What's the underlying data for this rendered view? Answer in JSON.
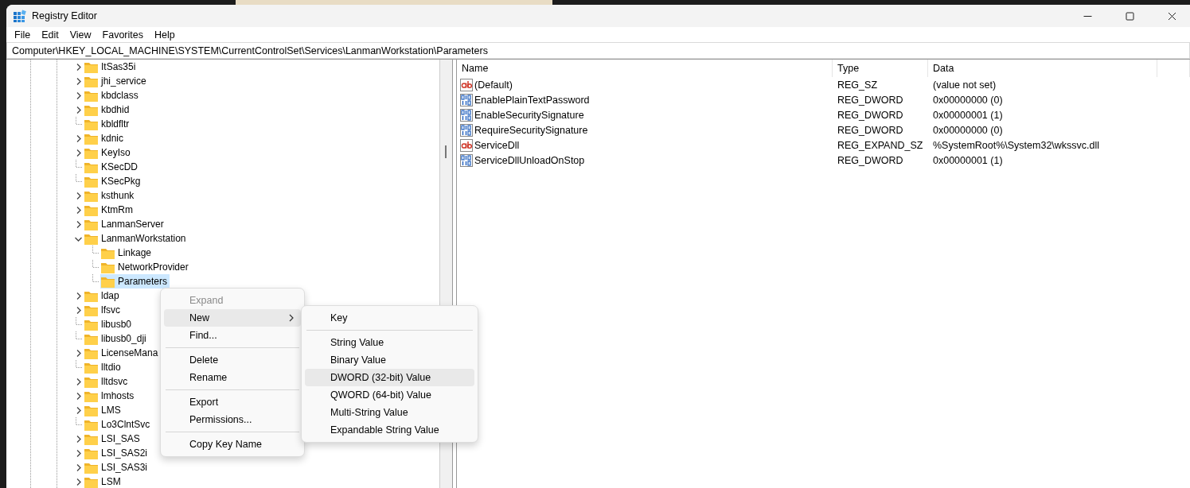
{
  "window": {
    "title": "Registry Editor"
  },
  "menu_bar": [
    {
      "label": "File"
    },
    {
      "label": "Edit"
    },
    {
      "label": "View"
    },
    {
      "label": "Favorites"
    },
    {
      "label": "Help"
    }
  ],
  "address_bar": {
    "value": "Computer\\HKEY_LOCAL_MACHINE\\SYSTEM\\CurrentControlSet\\Services\\LanmanWorkstation\\Parameters"
  },
  "tree": {
    "items": [
      {
        "label": "ItSas35i",
        "expandable": true,
        "expanded": false,
        "selected": false
      },
      {
        "label": "jhi_service",
        "expandable": true,
        "expanded": false,
        "selected": false
      },
      {
        "label": "kbdclass",
        "expandable": true,
        "expanded": false,
        "selected": false
      },
      {
        "label": "kbdhid",
        "expandable": true,
        "expanded": false,
        "selected": false
      },
      {
        "label": "kbldfltr",
        "expandable": false,
        "selected": false
      },
      {
        "label": "kdnic",
        "expandable": true,
        "expanded": false,
        "selected": false
      },
      {
        "label": "KeyIso",
        "expandable": true,
        "expanded": false,
        "selected": false
      },
      {
        "label": "KSecDD",
        "expandable": false,
        "selected": false
      },
      {
        "label": "KSecPkg",
        "expandable": false,
        "selected": false
      },
      {
        "label": "ksthunk",
        "expandable": true,
        "expanded": false,
        "selected": false
      },
      {
        "label": "KtmRm",
        "expandable": true,
        "expanded": false,
        "selected": false
      },
      {
        "label": "LanmanServer",
        "expandable": true,
        "expanded": false,
        "selected": false
      },
      {
        "label": "LanmanWorkstation",
        "expandable": true,
        "expanded": true,
        "selected": false,
        "children": [
          {
            "label": "Linkage",
            "expandable": false,
            "selected": false
          },
          {
            "label": "NetworkProvider",
            "expandable": false,
            "selected": false
          },
          {
            "label": "Parameters",
            "expandable": false,
            "selected": true
          }
        ]
      },
      {
        "label": "ldap",
        "expandable": true,
        "expanded": false,
        "selected": false
      },
      {
        "label": "lfsvc",
        "expandable": true,
        "expanded": false,
        "selected": false
      },
      {
        "label": "libusb0",
        "expandable": false,
        "selected": false
      },
      {
        "label": "libusb0_dji",
        "expandable": false,
        "selected": false
      },
      {
        "label": "LicenseMana",
        "expandable": true,
        "expanded": false,
        "selected": false
      },
      {
        "label": "lltdio",
        "expandable": false,
        "selected": false
      },
      {
        "label": "lltdsvc",
        "expandable": true,
        "expanded": false,
        "selected": false
      },
      {
        "label": "lmhosts",
        "expandable": true,
        "expanded": false,
        "selected": false
      },
      {
        "label": "LMS",
        "expandable": true,
        "expanded": false,
        "selected": false
      },
      {
        "label": "Lo3ClntSvc",
        "expandable": false,
        "selected": false
      },
      {
        "label": "LSI_SAS",
        "expandable": true,
        "expanded": false,
        "selected": false
      },
      {
        "label": "LSI_SAS2i",
        "expandable": true,
        "expanded": false,
        "selected": false
      },
      {
        "label": "LSI_SAS3i",
        "expandable": true,
        "expanded": false,
        "selected": false
      },
      {
        "label": "LSM",
        "expandable": true,
        "expanded": false,
        "selected": false
      }
    ]
  },
  "values_table": {
    "columns": [
      "Name",
      "Type",
      "Data"
    ],
    "rows": [
      {
        "kind": "string",
        "name": "(Default)",
        "type": "REG_SZ",
        "data": "(value not set)"
      },
      {
        "kind": "binary",
        "name": "EnablePlainTextPassword",
        "type": "REG_DWORD",
        "data": "0x00000000 (0)"
      },
      {
        "kind": "binary",
        "name": "EnableSecuritySignature",
        "type": "REG_DWORD",
        "data": "0x00000001 (1)"
      },
      {
        "kind": "binary",
        "name": "RequireSecuritySignature",
        "type": "REG_DWORD",
        "data": "0x00000000 (0)"
      },
      {
        "kind": "string",
        "name": "ServiceDll",
        "type": "REG_EXPAND_SZ",
        "data": "%SystemRoot%\\System32\\wkssvc.dll"
      },
      {
        "kind": "binary",
        "name": "ServiceDllUnloadOnStop",
        "type": "REG_DWORD",
        "data": "0x00000001 (1)"
      }
    ]
  },
  "context_menu": {
    "items": [
      {
        "kind": "item",
        "label": "Expand",
        "disabled": true,
        "selected": false,
        "submenu": false
      },
      {
        "kind": "item",
        "label": "New",
        "disabled": false,
        "selected": true,
        "submenu": true
      },
      {
        "kind": "item",
        "label": "Find...",
        "disabled": false,
        "selected": false,
        "submenu": false
      },
      {
        "kind": "separator"
      },
      {
        "kind": "item",
        "label": "Delete",
        "disabled": false,
        "selected": false,
        "submenu": false
      },
      {
        "kind": "item",
        "label": "Rename",
        "disabled": false,
        "selected": false,
        "submenu": false
      },
      {
        "kind": "separator"
      },
      {
        "kind": "item",
        "label": "Export",
        "disabled": false,
        "selected": false,
        "submenu": false
      },
      {
        "kind": "item",
        "label": "Permissions...",
        "disabled": false,
        "selected": false,
        "submenu": false
      },
      {
        "kind": "separator"
      },
      {
        "kind": "item",
        "label": "Copy Key Name",
        "disabled": false,
        "selected": false,
        "submenu": false
      }
    ]
  },
  "submenu": {
    "items": [
      {
        "kind": "item",
        "label": "Key",
        "disabled": false,
        "selected": false,
        "submenu": false
      },
      {
        "kind": "separator"
      },
      {
        "kind": "item",
        "label": "String Value",
        "disabled": false,
        "selected": false,
        "submenu": false
      },
      {
        "kind": "item",
        "label": "Binary Value",
        "disabled": false,
        "selected": false,
        "submenu": false
      },
      {
        "kind": "item",
        "label": "DWORD (32-bit) Value",
        "disabled": false,
        "selected": true,
        "submenu": false
      },
      {
        "kind": "item",
        "label": "QWORD (64-bit) Value",
        "disabled": false,
        "selected": false,
        "submenu": false
      },
      {
        "kind": "item",
        "label": "Multi-String Value",
        "disabled": false,
        "selected": false,
        "submenu": false
      },
      {
        "kind": "item",
        "label": "Expandable String Value",
        "disabled": false,
        "selected": false,
        "submenu": false
      }
    ]
  }
}
